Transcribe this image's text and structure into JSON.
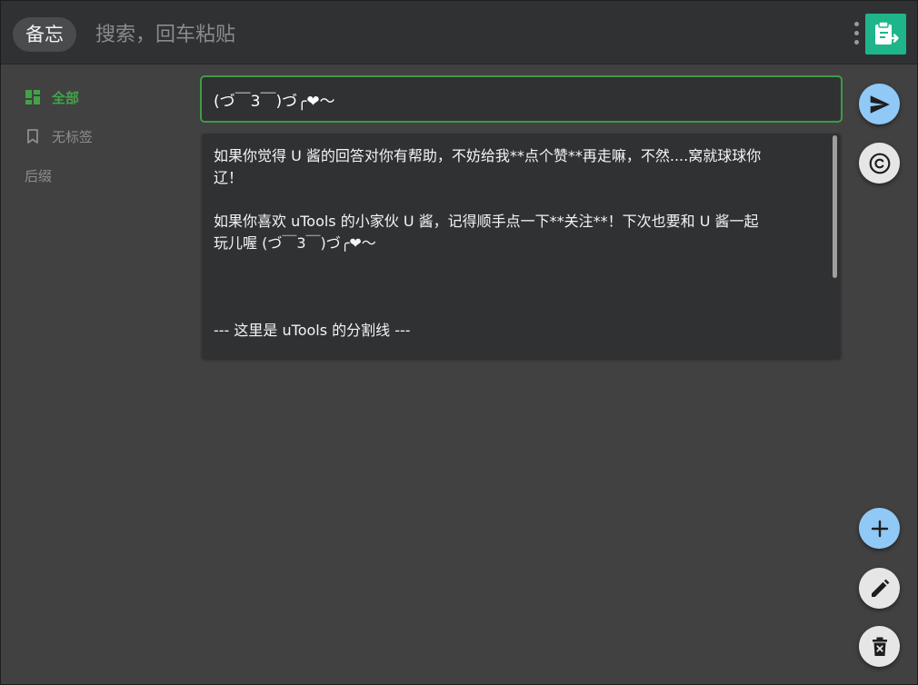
{
  "header": {
    "app_tag": "备忘",
    "search_placeholder": "搜索，回车粘贴",
    "search_value": "",
    "menu_icon": "more-vertical-icon",
    "logo_icon": "clipboard-export-icon"
  },
  "sidebar": {
    "items": [
      {
        "label": "全部",
        "icon": "dashboard-icon",
        "active": true
      },
      {
        "label": "无标签",
        "icon": "bookmark-icon",
        "active": false
      },
      {
        "label": "后缀",
        "icon": "",
        "active": false
      }
    ]
  },
  "editor": {
    "title_value": "(づ￣3￣)づ╭❤～",
    "content": "如果你觉得 U 酱的回答对你有帮助，不妨给我**点个赞**再走嘛，不然....窝就球球你\n辽！\n\n如果你喜欢 uTools 的小家伙 U 酱，记得顺手点一下**关注**！下次也要和 U 酱一起\n玩儿喔 (づ￣3￣)づ╭❤～\n\n\n\n--- 这里是 uTools 的分割线 ---"
  },
  "actions": {
    "send_icon": "send-icon",
    "copy_icon": "copyright-icon",
    "add_icon": "plus-icon",
    "edit_icon": "pencil-icon",
    "delete_icon": "trash-icon"
  },
  "colors": {
    "accent_green": "#41a348",
    "logo_green": "#1fb58a",
    "fab_blue": "#90c8f6",
    "fab_gray": "#e6e6e6",
    "background": "#414141",
    "panel": "#303133"
  }
}
